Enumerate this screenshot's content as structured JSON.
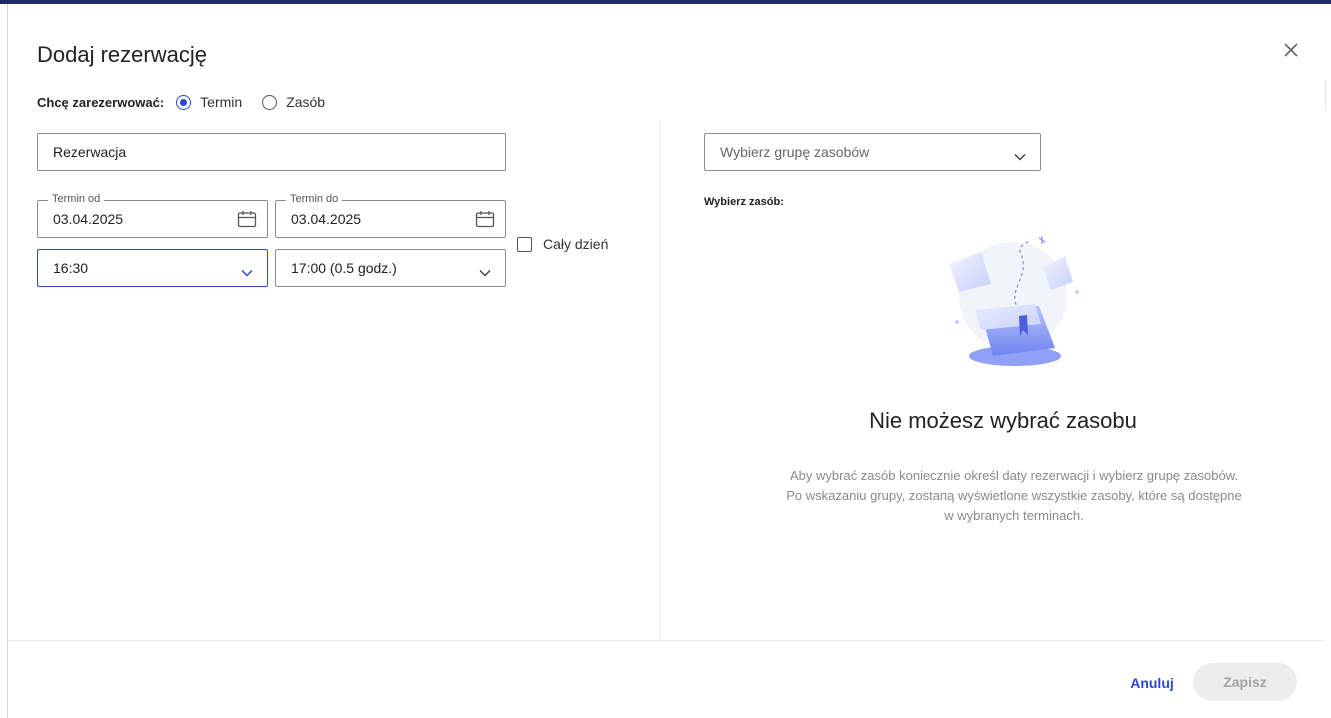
{
  "dialog": {
    "title": "Dodaj rezerwację",
    "close_icon": "close-icon"
  },
  "reserve_type": {
    "label": "Chcę zarezerwować:",
    "options": [
      {
        "label": "Termin",
        "selected": true
      },
      {
        "label": "Zasób",
        "selected": false
      }
    ]
  },
  "form": {
    "name_value": "Rezerwacja",
    "date_from": {
      "legend": "Termin od",
      "value": "03.04.2025"
    },
    "date_to": {
      "legend": "Termin do",
      "value": "03.04.2025"
    },
    "time_from": "16:30",
    "time_to": "17:00 (0.5 godz.)",
    "all_day_label": "Cały dzień",
    "all_day_checked": false
  },
  "resource_panel": {
    "group_placeholder": "Wybierz grupę zasobów",
    "select_label": "Wybierz zasób:",
    "empty_title": "Nie możesz wybrać zasobu",
    "empty_desc_line1": "Aby wybrać zasób koniecznie określ daty rezerwacji i wybierz grupę zasobów.",
    "empty_desc_line2": "Po wskazaniu grupy, zostaną wyświetlone wszystkie zasoby, które są dostępne",
    "empty_desc_line3": "w wybranych terminach."
  },
  "footer": {
    "cancel_label": "Anuluj",
    "save_label": "Zapisz"
  },
  "colors": {
    "accent": "#2d46d6",
    "topbar": "#1f2a6b",
    "disabled_bg": "#ededed",
    "disabled_text": "#a3a3a3"
  }
}
